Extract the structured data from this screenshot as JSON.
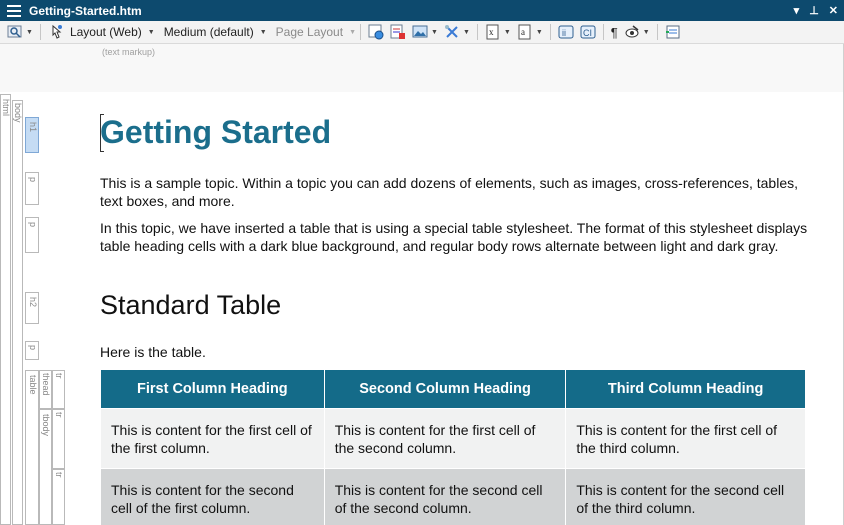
{
  "window": {
    "title": "Getting-Started.htm"
  },
  "toolbar": {
    "layout_label": "Layout (Web)",
    "medium_label": "Medium (default)",
    "page_layout_label": "Page Layout",
    "pilcrow": "¶"
  },
  "markup": {
    "hint": "(text markup)"
  },
  "structure": {
    "html": "html",
    "body": "body",
    "h1": "h1",
    "p1": "p",
    "p2": "p",
    "h2": "h2",
    "p3": "p",
    "table": "table",
    "thead": "thead",
    "tbody": "tbody",
    "tr1": "tr",
    "tr2": "tr",
    "tr3": "tr"
  },
  "document": {
    "heading": "Getting Started",
    "para1": "This is a sample topic. Within a topic you can add dozens of elements, such as images, cross-references, tables, text boxes, and more.",
    "para2": "In this topic, we have inserted a table that is using a special table stylesheet. The format of this stylesheet displays table heading cells with a dark blue background, and regular body rows alternate between light and dark gray.",
    "subheading": "Standard Table",
    "para3": "Here is the table.",
    "table": {
      "headers": [
        "First Column Heading",
        "Second Column Heading",
        "Third Column Heading"
      ],
      "rows": [
        [
          "This is content for the first cell of the first column.",
          "This is content for the first cell of the second column.",
          "This is content for the first cell of the third column."
        ],
        [
          "This is content for the second cell of the first column.",
          "This is content for the second cell of the second column.",
          "This is content for the second cell of the third column."
        ]
      ]
    }
  },
  "colors": {
    "titlebar": "#0d4a6e",
    "heading": "#1b6e8c",
    "table_header": "#146b89",
    "row_light": "#f1f2f2",
    "row_dark": "#d1d3d4"
  }
}
